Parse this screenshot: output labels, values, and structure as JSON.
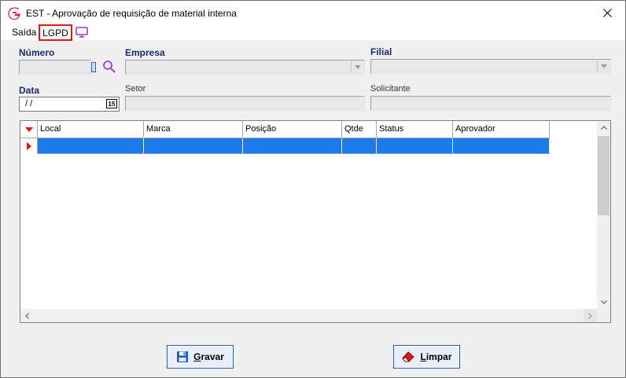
{
  "window": {
    "title": "EST - Aprovação de requisição de material interna",
    "close_symbol": "✕"
  },
  "menu": {
    "items": [
      "Saída",
      "LGPD"
    ],
    "highlighted_item": "LGPD",
    "monitor_icon": "monitor-icon"
  },
  "form": {
    "numero": {
      "label": "Número",
      "value": ""
    },
    "empresa": {
      "label": "Empresa",
      "value": ""
    },
    "filial": {
      "label": "Filial",
      "value": ""
    },
    "data": {
      "label": "Data",
      "value": " /  /",
      "calendar_label": "15"
    },
    "setor": {
      "label": "Setor",
      "value": ""
    },
    "solicitante": {
      "label": "Solicitante",
      "value": ""
    }
  },
  "grid": {
    "columns": [
      "Local",
      "Marca",
      "Posição",
      "Qtde",
      "Status",
      "Aprovador"
    ],
    "rows": [
      {
        "Local": "",
        "Marca": "",
        "Posição": "",
        "Qtde": "",
        "Status": "",
        "Aprovador": ""
      }
    ],
    "selected_row_color": "#1c7be8"
  },
  "buttons": {
    "gravar": {
      "label_first": "G",
      "label_rest": "ravar"
    },
    "limpar": {
      "label_first": "L",
      "label_rest": "impar"
    }
  },
  "colors": {
    "label_blue": "#1c2b6e",
    "lgpd_highlight": "#e0161b",
    "accent_purple": "#9b3fd9"
  }
}
